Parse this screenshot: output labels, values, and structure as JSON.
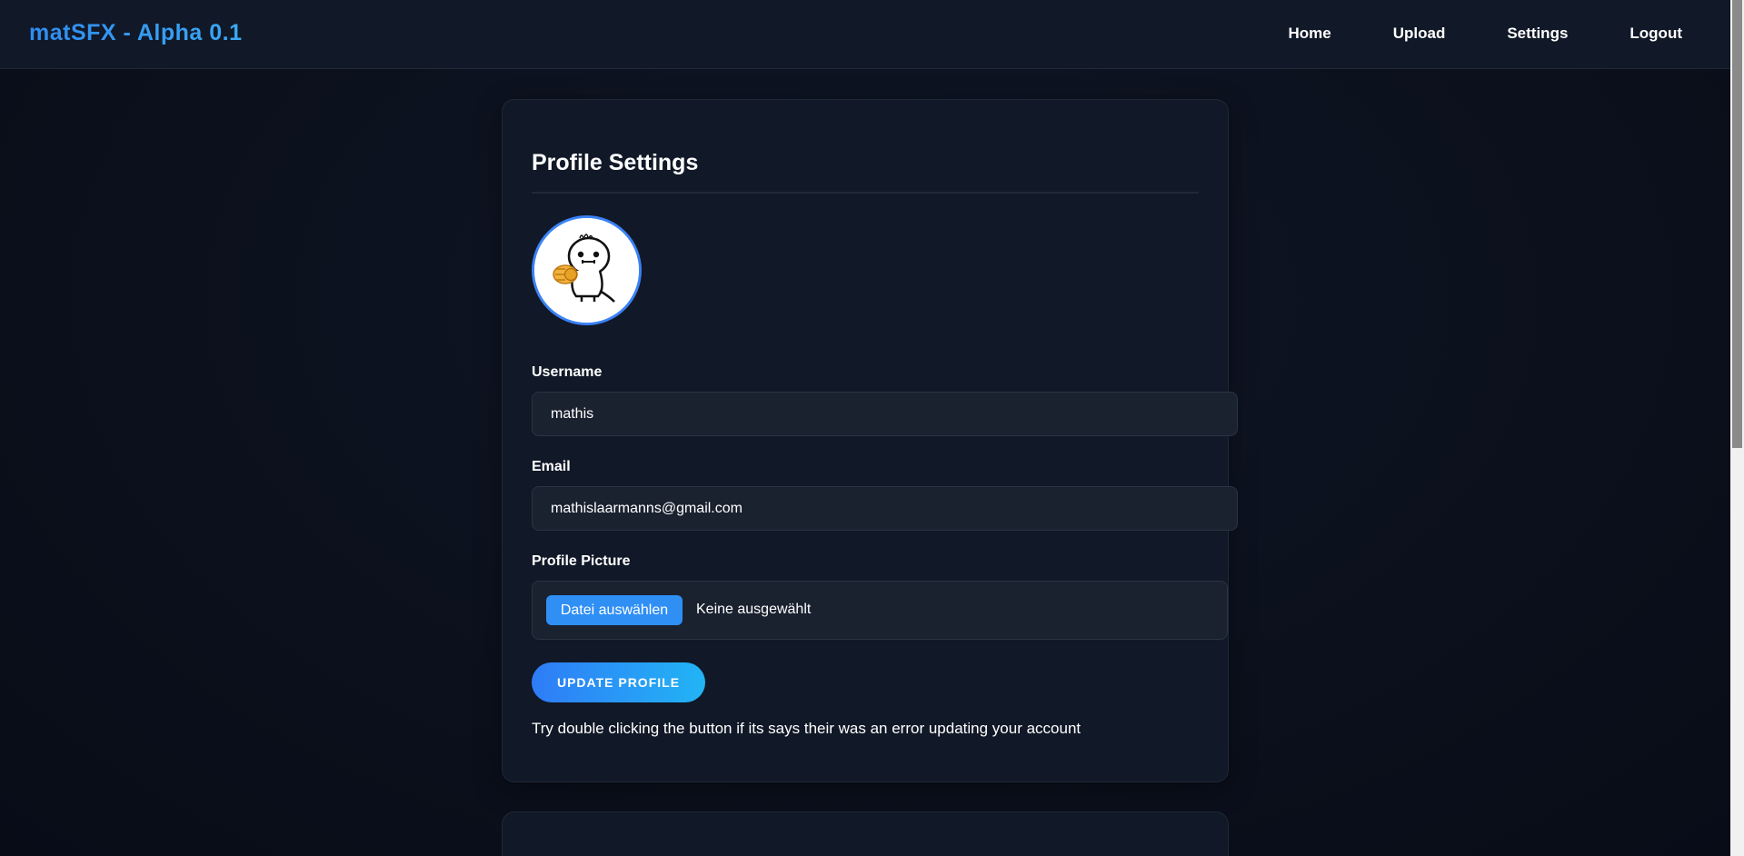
{
  "brand": "matSFX - Alpha 0.1",
  "nav": {
    "home": "Home",
    "upload": "Upload",
    "settings": "Settings",
    "logout": "Logout"
  },
  "profile": {
    "title": "Profile Settings",
    "avatar_icon": "profile-picture",
    "username_label": "Username",
    "username_value": "mathis",
    "email_label": "Email",
    "email_value": "mathislaarmanns@gmail.com",
    "picture_label": "Profile Picture",
    "file_button": "Datei auswählen",
    "file_status": "Keine ausgewählt",
    "update_button": "UPDATE PROFILE",
    "hint": "Try double clicking the button if its says their was an error updating your account"
  },
  "colors": {
    "accent": "#3b82f6",
    "brand": "#3b9cf5",
    "background": "#0b101c",
    "card": "#111827"
  }
}
